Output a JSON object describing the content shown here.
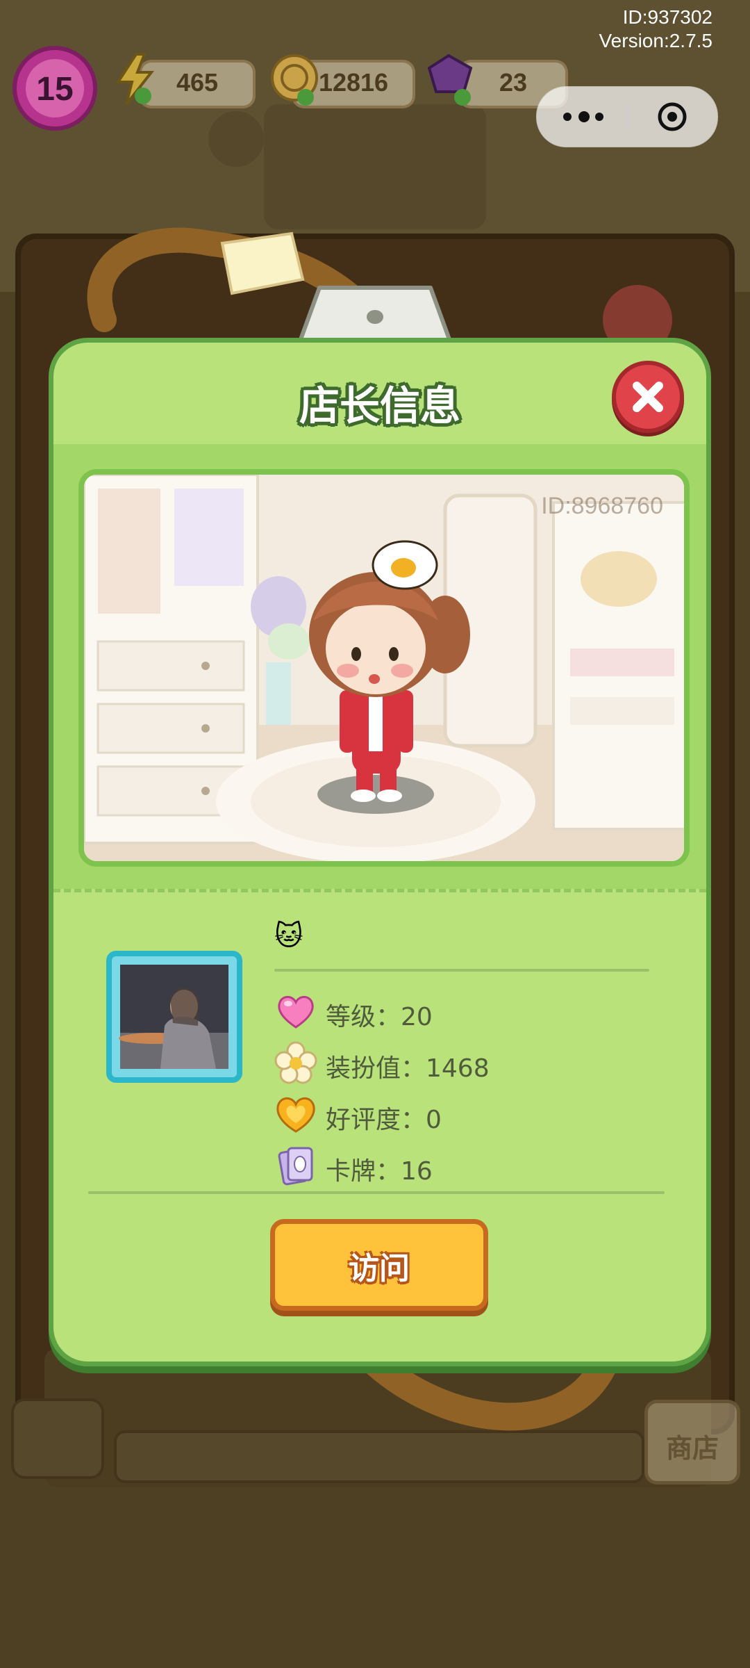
{
  "system": {
    "id_label": "ID:937302",
    "version_label": "Version:2.7.5"
  },
  "hud": {
    "level": "15",
    "energy": "465",
    "coins": "12816",
    "gems": "23"
  },
  "dialog": {
    "title": "店长信息",
    "shop_id": "ID:8968760",
    "nickname_emoji": "🐱",
    "stats": [
      {
        "icon": "heart-icon",
        "label": "等级：20"
      },
      {
        "icon": "flower-icon",
        "label": "装扮值：1468"
      },
      {
        "icon": "golden-heart-icon",
        "label": "好评度：0"
      },
      {
        "icon": "card-icon",
        "label": "卡牌：16"
      }
    ],
    "visit_button": "访问"
  },
  "background": {
    "shop_tab": "商店"
  },
  "colors": {
    "panel_green": "#b9e27b",
    "panel_border": "#5ea445",
    "close_red": "#e0444a",
    "visit_yellow": "#ffc23a",
    "avatar_frame": "#2bb6c9"
  }
}
